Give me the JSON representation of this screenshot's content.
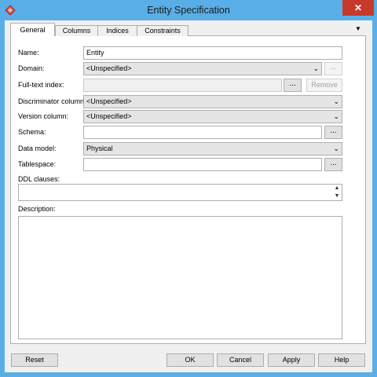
{
  "window": {
    "title": "Entity Specification",
    "close_glyph": "✕",
    "accent": "#5aaee8",
    "close_color": "#c7392b"
  },
  "tabs": [
    {
      "label": "General",
      "active": true
    },
    {
      "label": "Columns",
      "active": false
    },
    {
      "label": "Indices",
      "active": false
    },
    {
      "label": "Constraints",
      "active": false
    }
  ],
  "tab_overflow_glyph": "▼",
  "form": {
    "name": {
      "label": "Name:",
      "value": "Entity"
    },
    "domain": {
      "label": "Domain:",
      "value": "<Unspecified>",
      "button": "..."
    },
    "fulltext": {
      "label": "Full-text index:",
      "value": "",
      "button": "...",
      "remove": "Remove"
    },
    "discriminator": {
      "label": "Discriminator column:",
      "value": "<Unspecified>"
    },
    "version": {
      "label": "Version column:",
      "value": "<Unspecified>"
    },
    "schema": {
      "label": "Schema:",
      "value": "",
      "button": "..."
    },
    "data_model": {
      "label": "Data model:",
      "value": "Physical"
    },
    "tablespace": {
      "label": "Tablespace:",
      "value": "",
      "button": "..."
    },
    "ddl": {
      "label": "DDL clauses:",
      "value": ""
    },
    "description": {
      "label": "Description:",
      "value": ""
    }
  },
  "buttons": {
    "reset": "Reset",
    "ok": "OK",
    "cancel": "Cancel",
    "apply": "Apply",
    "help": "Help"
  }
}
